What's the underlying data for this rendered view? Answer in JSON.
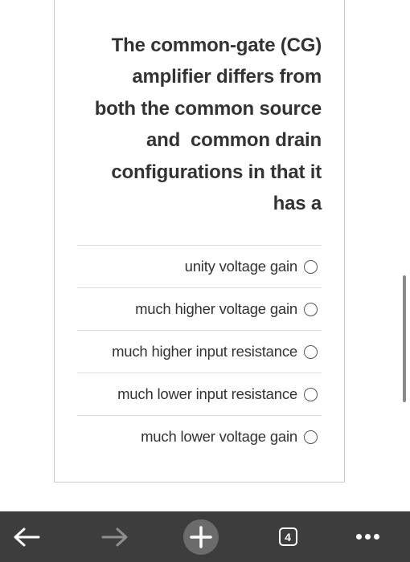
{
  "question": {
    "lines": [
      "The common-gate (CG)",
      "amplifier differs from",
      "both the common source",
      "and  common drain",
      "configurations in that it",
      "has a"
    ]
  },
  "options": [
    {
      "label": "unity voltage gain",
      "selected": false
    },
    {
      "label": "much higher voltage gain",
      "selected": false
    },
    {
      "label": "much higher input resistance",
      "selected": false
    },
    {
      "label": "much lower input resistance",
      "selected": false
    },
    {
      "label": "much lower voltage gain",
      "selected": false
    }
  ],
  "toolbar": {
    "tab_count": "4",
    "icons": [
      "back-arrow-icon",
      "forward-arrow-icon",
      "plus-icon",
      "tabs-icon",
      "more-dots-icon"
    ]
  },
  "colors": {
    "toolbar_bg": "#3d3d3d",
    "text": "#333333",
    "forward_disabled": "#8f8f8f"
  }
}
